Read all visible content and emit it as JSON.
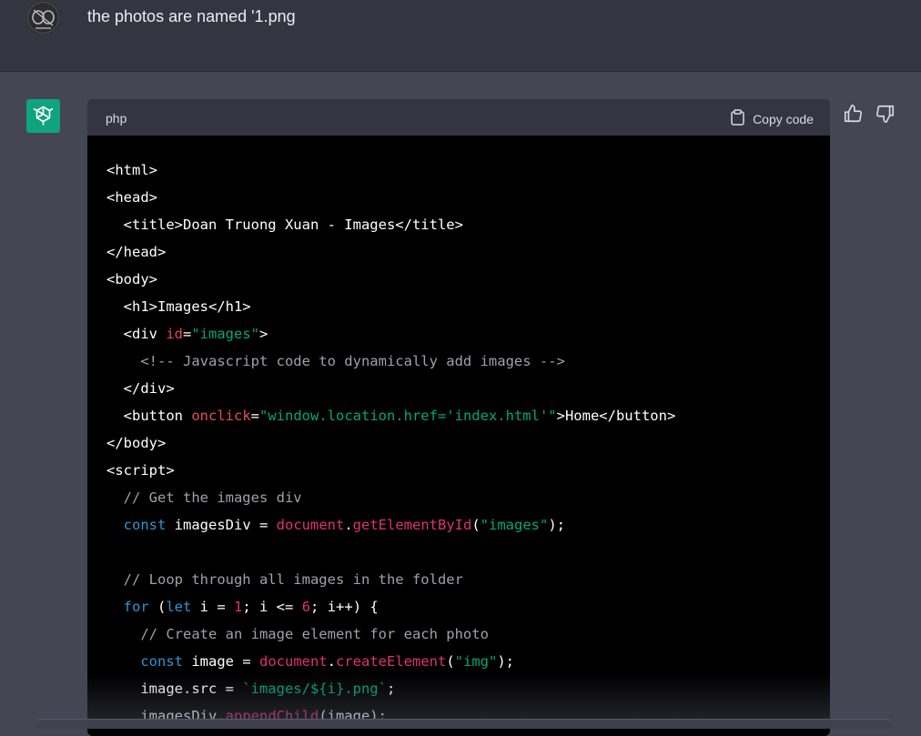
{
  "user_message": {
    "text": "the photos are named '1.png"
  },
  "code_block": {
    "language": "php",
    "copy_label": "Copy code",
    "lines": [
      [
        [
          "t",
          "<html>"
        ]
      ],
      [
        [
          "t",
          "<head>"
        ]
      ],
      [
        [
          "t",
          "  <title>Doan Truong Xuan - Images</title>"
        ]
      ],
      [
        [
          "t",
          "</head>"
        ]
      ],
      [
        [
          "t",
          "<body>"
        ]
      ],
      [
        [
          "t",
          "  <h1>Images</h1>"
        ]
      ],
      [
        [
          "t",
          "  <div "
        ],
        [
          "attr",
          "id"
        ],
        [
          "t",
          "="
        ],
        [
          "str",
          "\"images\""
        ],
        [
          "t",
          ">"
        ]
      ],
      [
        [
          "com",
          "    <!-- Javascript code to dynamically add images -->"
        ]
      ],
      [
        [
          "t",
          "  </div>"
        ]
      ],
      [
        [
          "t",
          "  <button "
        ],
        [
          "attr",
          "onclick"
        ],
        [
          "t",
          "="
        ],
        [
          "str",
          "\"window.location.href='index.html'\""
        ],
        [
          "t",
          ">Home</button>"
        ]
      ],
      [
        [
          "t",
          "</body>"
        ]
      ],
      [
        [
          "t",
          "<script>"
        ]
      ],
      [
        [
          "com",
          "  // Get the images div"
        ]
      ],
      [
        [
          "t",
          "  "
        ],
        [
          "kw",
          "const"
        ],
        [
          "t",
          " imagesDiv = "
        ],
        [
          "fn",
          "document"
        ],
        [
          "t",
          "."
        ],
        [
          "fn",
          "getElementById"
        ],
        [
          "t",
          "("
        ],
        [
          "str",
          "\"images\""
        ],
        [
          "t",
          ");"
        ]
      ],
      [
        [
          "t",
          ""
        ]
      ],
      [
        [
          "com",
          "  // Loop through all images in the folder"
        ]
      ],
      [
        [
          "t",
          "  "
        ],
        [
          "kw",
          "for"
        ],
        [
          "t",
          " ("
        ],
        [
          "kw",
          "let"
        ],
        [
          "t",
          " i = "
        ],
        [
          "num",
          "1"
        ],
        [
          "t",
          "; i <= "
        ],
        [
          "num",
          "6"
        ],
        [
          "t",
          "; i++) {"
        ]
      ],
      [
        [
          "com",
          "    // Create an image element for each photo"
        ]
      ],
      [
        [
          "t",
          "    "
        ],
        [
          "kw",
          "const"
        ],
        [
          "t",
          " image = "
        ],
        [
          "fn",
          "document"
        ],
        [
          "t",
          "."
        ],
        [
          "fn",
          "createElement"
        ],
        [
          "t",
          "("
        ],
        [
          "str",
          "\"img\""
        ],
        [
          "t",
          ");"
        ]
      ],
      [
        [
          "t",
          "    image.src = "
        ],
        [
          "tpl",
          "`images/${i}.png`"
        ],
        [
          "t",
          ";"
        ]
      ],
      [
        [
          "t",
          "    imagesDiv."
        ],
        [
          "fn",
          "appendChild"
        ],
        [
          "t",
          "(image);"
        ]
      ]
    ]
  },
  "colors": {
    "background": "#444654",
    "user_background": "#343541",
    "code_background": "#000000",
    "accent": "#10a37f"
  },
  "icons": [
    "user-avatar-icon",
    "openai-logo-icon",
    "clipboard-icon",
    "thumbs-up-icon",
    "thumbs-down-icon"
  ]
}
